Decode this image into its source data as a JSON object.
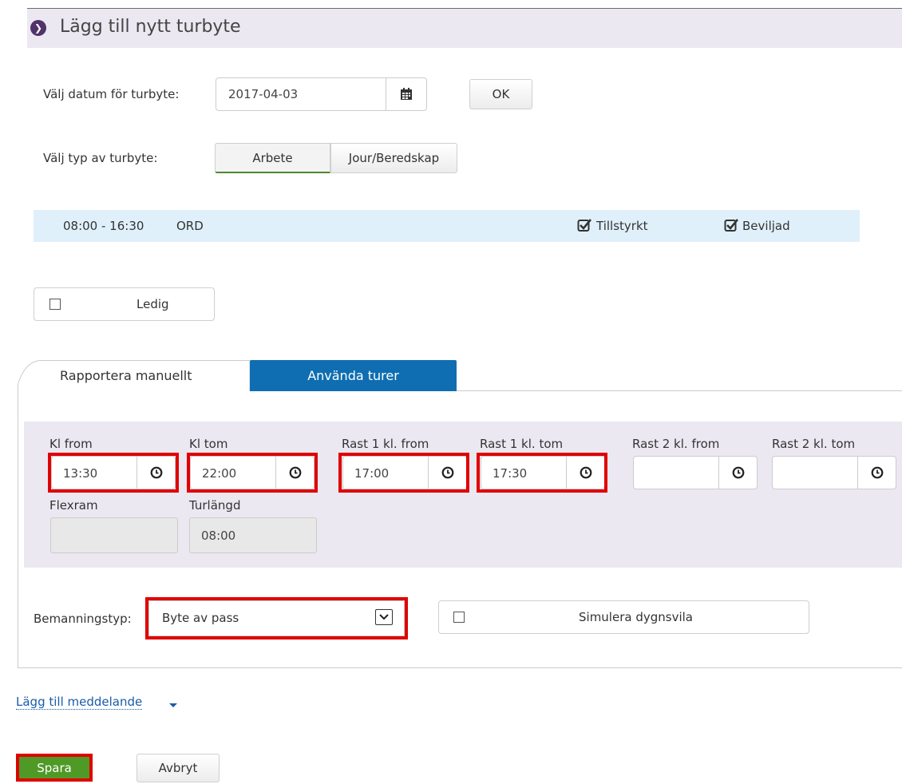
{
  "header": {
    "title": "Lägg till nytt turbyte",
    "icon": "chevron-right-circle-icon"
  },
  "date": {
    "label": "Välj datum för turbyte:",
    "value": "2017-04-03",
    "ok_label": "OK"
  },
  "type": {
    "label": "Välj typ av turbyte:",
    "options": [
      "Arbete",
      "Jour/Beredskap"
    ],
    "selected": "Arbete"
  },
  "shift": {
    "time": "08:00 - 16:30",
    "code": "ORD",
    "tillstyrkt": "Tillstyrkt",
    "beviljad": "Beviljad"
  },
  "ledig": {
    "label": "Ledig",
    "checked": false
  },
  "tabs": {
    "manual": "Rapportera manuellt",
    "use_shifts": "Använda turer",
    "active": "Använda turer"
  },
  "times": {
    "kl_from": {
      "label": "Kl from",
      "value": "13:30"
    },
    "kl_tom": {
      "label": "Kl tom",
      "value": "22:00"
    },
    "rast1_from": {
      "label": "Rast 1 kl. from",
      "value": "17:00"
    },
    "rast1_tom": {
      "label": "Rast 1 kl. tom",
      "value": "17:30"
    },
    "rast2_from": {
      "label": "Rast 2 kl. from",
      "value": ""
    },
    "rast2_tom": {
      "label": "Rast 2 kl. tom",
      "value": ""
    },
    "flexram": {
      "label": "Flexram",
      "value": ""
    },
    "turlangd": {
      "label": "Turlängd",
      "value": "08:00"
    }
  },
  "bemanning": {
    "label": "Bemanningstyp:",
    "value": "Byte av pass"
  },
  "simulera": {
    "label": "Simulera dygnsvila",
    "checked": false
  },
  "message_link": "Lägg till meddelande",
  "buttons": {
    "save": "Spara",
    "cancel": "Avbryt"
  },
  "colors": {
    "header_bg": "#ece8f2",
    "accent_purple": "#51326b",
    "tab_blue": "#0f6eb2",
    "save_green": "#4f9a27",
    "highlight_red": "#e00000",
    "shift_row_bg": "#dff0fb"
  }
}
